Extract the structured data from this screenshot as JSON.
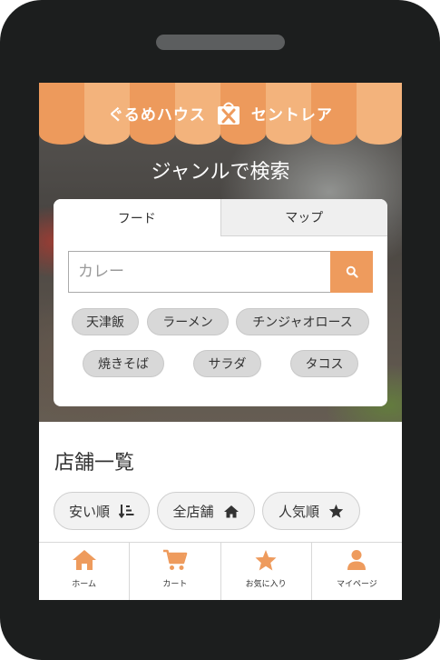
{
  "header": {
    "brand_left": "ぐるめハウス",
    "brand_right": "セントレア",
    "title": "ジャンルで検索"
  },
  "search": {
    "tabs": [
      {
        "label": "フード",
        "active": true
      },
      {
        "label": "マップ",
        "active": false
      }
    ],
    "placeholder": "カレー",
    "button_icon": "search-icon",
    "chips": [
      "天津飯",
      "ラーメン",
      "チンジャオロース",
      "焼きそば",
      "サラダ",
      "タコス"
    ]
  },
  "store_list": {
    "title": "店舗一覧",
    "sort_buttons": [
      {
        "label": "安い順",
        "icon": "sort-ascending-icon"
      },
      {
        "label": "全店舗",
        "icon": "home-icon"
      },
      {
        "label": "人気順",
        "icon": "star-icon"
      }
    ]
  },
  "bottom_nav": {
    "items": [
      {
        "label": "ホーム",
        "icon": "home-icon"
      },
      {
        "label": "カート",
        "icon": "cart-icon"
      },
      {
        "label": "お気に入り",
        "icon": "star-icon"
      },
      {
        "label": "マイページ",
        "icon": "user-icon"
      }
    ]
  },
  "colors": {
    "accent": "#ee9b5d",
    "awning_light": "#f3b37c",
    "frame": "#1c1e1e"
  }
}
